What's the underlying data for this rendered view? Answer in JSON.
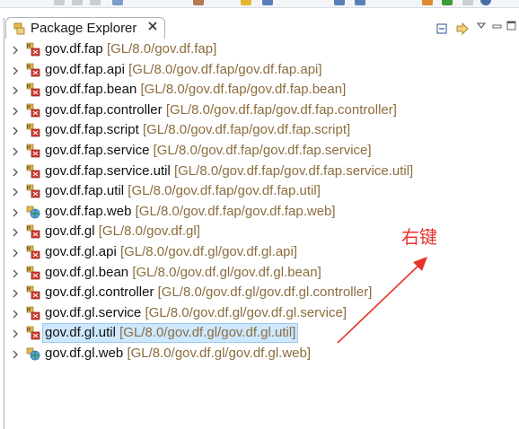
{
  "view": {
    "title": "Package Explorer",
    "close_icon": "close-x-icon",
    "view_icon": "package-explorer-icon"
  },
  "toolbar": {
    "icons": [
      "collapse-all-icon",
      "link-with-editor-icon",
      "view-menu-icon",
      "minimize-icon",
      "maximize-icon"
    ]
  },
  "packages": [
    {
      "name": "gov.df.fap",
      "path": "[GL/8.0/gov.df.fap]",
      "icon": "jar-package-icon"
    },
    {
      "name": "gov.df.fap.api",
      "path": "[GL/8.0/gov.df.fap/gov.df.fap.api]",
      "icon": "jar-package-icon"
    },
    {
      "name": "gov.df.fap.bean",
      "path": "[GL/8.0/gov.df.fap/gov.df.fap.bean]",
      "icon": "jar-package-icon"
    },
    {
      "name": "gov.df.fap.controller",
      "path": "[GL/8.0/gov.df.fap/gov.df.fap.controller]",
      "icon": "jar-package-icon"
    },
    {
      "name": "gov.df.fap.script",
      "path": "[GL/8.0/gov.df.fap/gov.df.fap.script]",
      "icon": "jar-package-icon"
    },
    {
      "name": "gov.df.fap.service",
      "path": "[GL/8.0/gov.df.fap/gov.df.fap.service]",
      "icon": "jar-package-icon"
    },
    {
      "name": "gov.df.fap.service.util",
      "path": "[GL/8.0/gov.df.fap/gov.df.fap.service.util]",
      "icon": "jar-package-icon"
    },
    {
      "name": "gov.df.fap.util",
      "path": "[GL/8.0/gov.df.fap/gov.df.fap.util]",
      "icon": "jar-package-icon"
    },
    {
      "name": "gov.df.fap.web",
      "path": "[GL/8.0/gov.df.fap/gov.df.fap.web]",
      "icon": "web-project-icon"
    },
    {
      "name": "gov.df.gl",
      "path": "[GL/8.0/gov.df.gl]",
      "icon": "jar-package-icon"
    },
    {
      "name": "gov.df.gl.api",
      "path": "[GL/8.0/gov.df.gl/gov.df.gl.api]",
      "icon": "jar-package-icon"
    },
    {
      "name": "gov.df.gl.bean",
      "path": "[GL/8.0/gov.df.gl/gov.df.gl.bean]",
      "icon": "jar-package-icon"
    },
    {
      "name": "gov.df.gl.controller",
      "path": "[GL/8.0/gov.df.gl/gov.df.gl.controller]",
      "icon": "jar-package-icon"
    },
    {
      "name": "gov.df.gl.service",
      "path": "[GL/8.0/gov.df.gl/gov.df.gl.service]",
      "icon": "jar-package-icon"
    },
    {
      "name": "gov.df.gl.util",
      "path": "[GL/8.0/gov.df.gl/gov.df.gl.util]",
      "icon": "jar-package-icon",
      "selected": true
    },
    {
      "name": "gov.df.gl.web",
      "path": "[GL/8.0/gov.df.gl/gov.df.gl.web]",
      "icon": "web-project-icon"
    }
  ],
  "annotation": {
    "text": "右键",
    "color": "#e8322c"
  },
  "colors": {
    "path_text": "#8c6d3f",
    "selection_bg": "#cde8ff",
    "selection_border": "#99c9ef"
  }
}
